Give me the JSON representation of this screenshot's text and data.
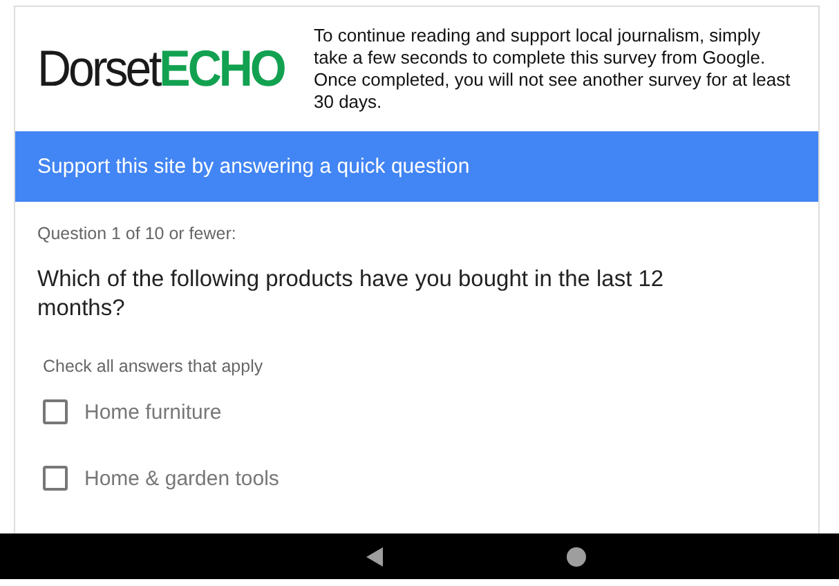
{
  "logo": {
    "dark": "Dorset",
    "accent": "ECHO"
  },
  "intro": "To continue reading and support local journalism, simply take a few seconds to complete this survey from Google. Once completed, you will not see another survey for at least 30 days.",
  "banner": "Support this site by answering a quick question",
  "progress": "Question 1 of 10 or fewer:",
  "question": "Which of the following products have you bought in the last 12 months?",
  "hint": "Check all answers that apply",
  "options": [
    {
      "label": "Home furniture",
      "checked": false
    },
    {
      "label": "Home & garden tools",
      "checked": false
    }
  ]
}
